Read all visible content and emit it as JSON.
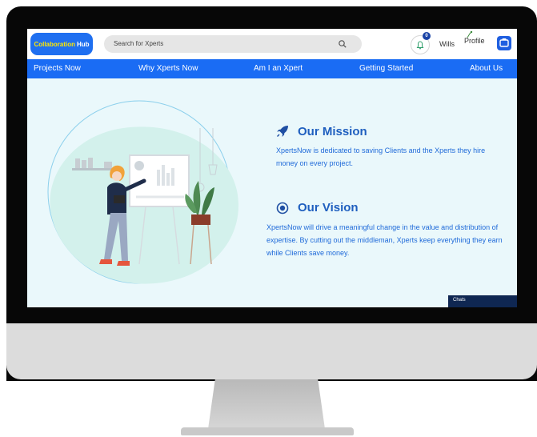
{
  "header": {
    "logo": {
      "part1": "Collaboration",
      "part2": "Hub"
    },
    "search": {
      "placeholder": "Search for Xperts"
    },
    "notifications": {
      "count": "0"
    },
    "user_name": "Wills",
    "profile_label": "Profile"
  },
  "nav": {
    "items": [
      {
        "label": "Projects Now"
      },
      {
        "label": "Why Xperts Now"
      },
      {
        "label": "Am I an Xpert"
      },
      {
        "label": "Getting Started"
      },
      {
        "label": "About Us"
      }
    ]
  },
  "mission": {
    "title": "Our Mission",
    "text": "XpertsNow is dedicated to saving Clients and the Xperts they hire money on every project."
  },
  "vision": {
    "title": "Our Vision",
    "text": "XpertsNow will drive a meaningful change in the value and distribution of expertise. By cutting out the middleman, Xperts keep everything they earn while Clients save money."
  },
  "chat": {
    "label": "Chats"
  },
  "colors": {
    "accent": "#1a6cf4",
    "heading": "#1f5fbf",
    "body_text": "#1f6ad9",
    "background": "#eaf8fb"
  },
  "icons": {
    "search": "search-icon",
    "notifications": "bell-icon",
    "mission": "rocket-icon",
    "vision": "target-icon"
  }
}
